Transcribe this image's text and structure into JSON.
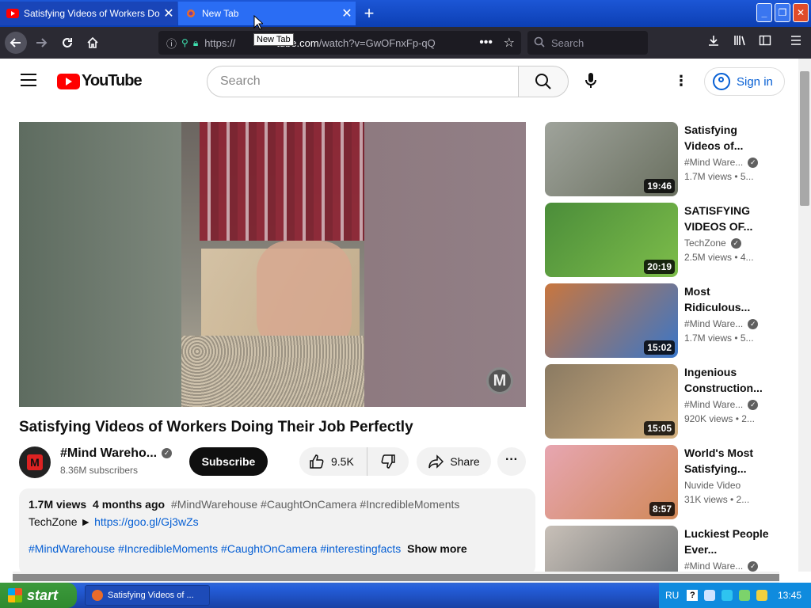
{
  "browser": {
    "tabs": [
      {
        "title": "Satisfying Videos of Workers Doing",
        "active": false
      },
      {
        "title": "New Tab",
        "active": true
      }
    ],
    "new_tab_symbol": "+",
    "tab_close_symbol": "✕",
    "tooltip": "New Tab",
    "url_prefix": "https://",
    "url_domain": "tube.com",
    "url_path": "/watch?v=GwOFnxFp-qQ",
    "search_placeholder": "Search",
    "window_buttons": {
      "minimize": "_",
      "maximize": "❐",
      "close": "✕"
    }
  },
  "youtube": {
    "logo_text": "YouTube",
    "search_placeholder": "Search",
    "sign_in": "Sign in",
    "video": {
      "title": "Satisfying Videos of Workers Doing Their Job Perfectly",
      "watermark": "M",
      "channel": "#Mind Wareho...",
      "subscribers": "8.36M subscribers",
      "subscribe_label": "Subscribe",
      "likes": "9.5K",
      "share_label": "Share",
      "more_label": "···"
    },
    "description": {
      "views": "1.7M views",
      "age": "4 months ago",
      "tags_line": "#MindWarehouse #CaughtOnCamera #IncredibleMoments",
      "line2_prefix": "TechZone ► ",
      "line2_link": "https://goo.gl/Gj3wZs",
      "hashtags": "#MindWarehouse #IncredibleMoments #CaughtOnCamera #interestingfacts",
      "show_more": "Show more"
    },
    "recommendations": [
      {
        "title": "Satisfying Videos of...",
        "channel": "#Mind Ware...",
        "verified": true,
        "meta": "1.7M views  • 5...",
        "duration": "19:46",
        "colors": [
          "#9fa39b",
          "#6a7060"
        ]
      },
      {
        "title": "SATISFYING VIDEOS OF...",
        "channel": "TechZone",
        "verified": true,
        "meta": "2.5M views  • 4...",
        "duration": "20:19",
        "colors": [
          "#4b8d3a",
          "#7dbd4a"
        ]
      },
      {
        "title": "Most Ridiculous...",
        "channel": "#Mind Ware...",
        "verified": true,
        "meta": "1.7M views  • 5...",
        "duration": "15:02",
        "colors": [
          "#c9763e",
          "#3a76c8"
        ]
      },
      {
        "title": "Ingenious Construction...",
        "channel": "#Mind Ware...",
        "verified": true,
        "meta": "920K views  • 2...",
        "duration": "15:05",
        "colors": [
          "#8a7a62",
          "#d2b080"
        ]
      },
      {
        "title": "World's Most Satisfying...",
        "channel": "Nuvide Video",
        "verified": false,
        "meta": "31K views  • 2...",
        "duration": "8:57",
        "colors": [
          "#e7a6b1",
          "#d08858"
        ]
      },
      {
        "title": "Luckiest People Ever...",
        "channel": "#Mind Ware...",
        "verified": true,
        "meta": "",
        "duration": "",
        "colors": [
          "#c8c0b8",
          "#6a6e70"
        ]
      }
    ]
  },
  "taskbar": {
    "start_label": "start",
    "task_item": "Satisfying Videos of ...",
    "language": "RU",
    "help": "?",
    "clock": "13:45"
  }
}
